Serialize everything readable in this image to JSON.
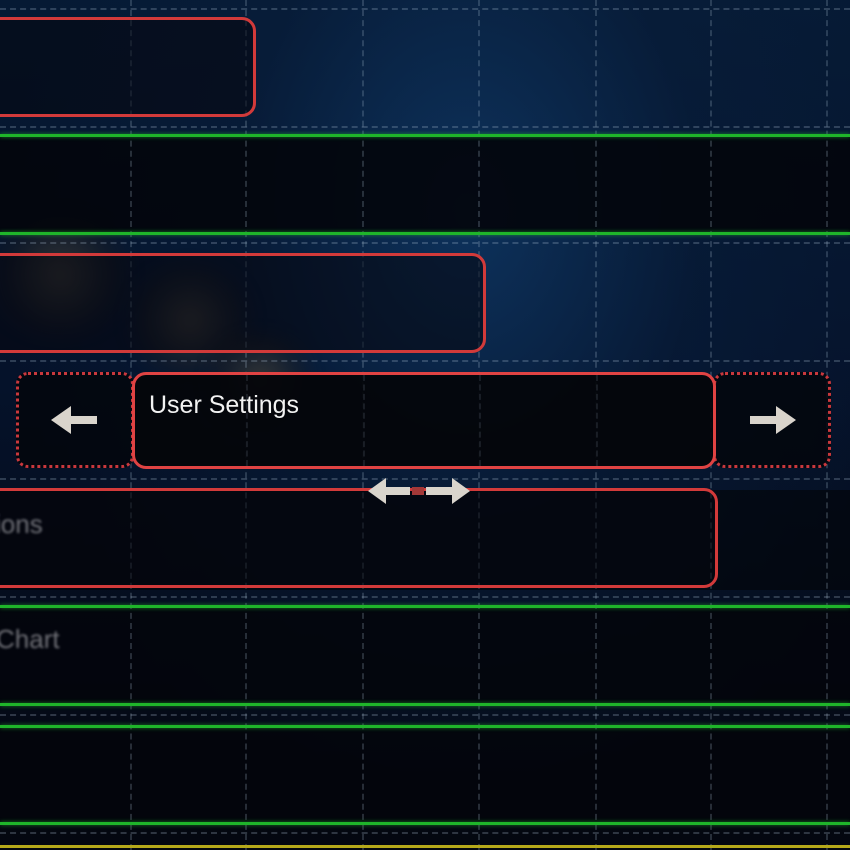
{
  "items": {
    "partial_1": "ions",
    "partial_2": "Chart"
  },
  "selected_item": {
    "label": "User Settings"
  },
  "controls": {
    "prev_icon": "arrow-left-icon",
    "next_icon": "arrow-right-icon",
    "resize_icon": "resize-horizontal-icon"
  },
  "colors": {
    "selection_border": "#e04343",
    "row_separator": "#1fb52a",
    "bottom_rule": "#b6a91a",
    "arrow": "#d9d4cc"
  }
}
